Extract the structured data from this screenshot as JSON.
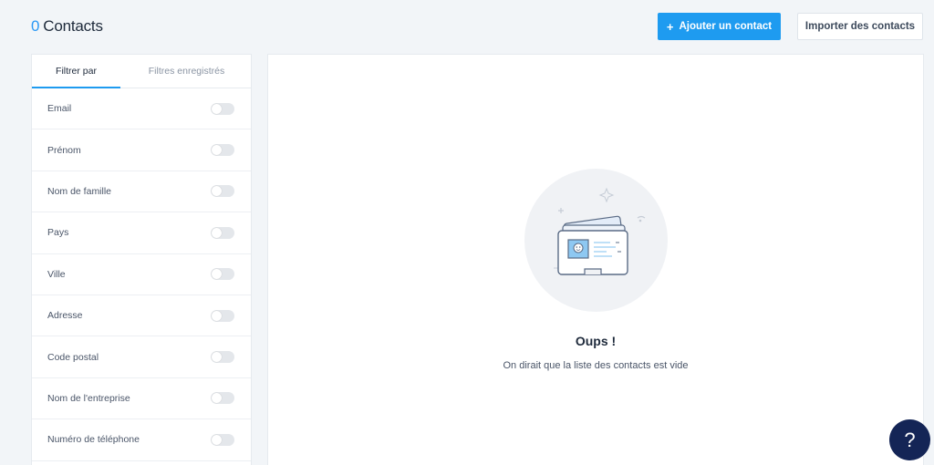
{
  "header": {
    "count": "0",
    "title": "Contacts",
    "add_button_icon": "+",
    "add_button_label": "Ajouter un contact",
    "import_button_label": "Importer des contacts"
  },
  "sidebar": {
    "tabs": [
      {
        "label": "Filtrer par",
        "active": true
      },
      {
        "label": "Filtres enregistrés",
        "active": false
      }
    ],
    "filters": [
      {
        "label": "Email",
        "enabled": false
      },
      {
        "label": "Prénom",
        "enabled": false
      },
      {
        "label": "Nom de famille",
        "enabled": false
      },
      {
        "label": "Pays",
        "enabled": false
      },
      {
        "label": "Ville",
        "enabled": false
      },
      {
        "label": "Adresse",
        "enabled": false
      },
      {
        "label": "Code postal",
        "enabled": false
      },
      {
        "label": "Nom de l'entreprise",
        "enabled": false
      },
      {
        "label": "Numéro de téléphone",
        "enabled": false
      }
    ]
  },
  "empty_state": {
    "icon": "contact-card-illustration",
    "title": "Oups !",
    "message": "On dirait que la liste des contacts est vide"
  },
  "help": {
    "icon": "?"
  },
  "colors": {
    "accent": "#1e9bf0",
    "help_button": "#142556",
    "background": "#f2f5f8"
  }
}
